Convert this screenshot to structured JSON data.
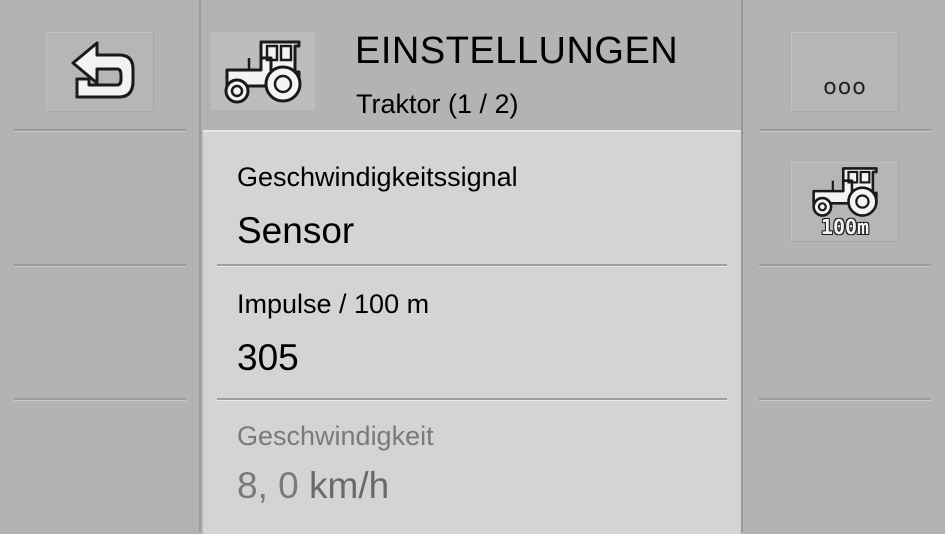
{
  "header": {
    "title": "EINSTELLUNGEN",
    "subtitle": "Traktor (1 / 2)",
    "icon": "tractor-icon"
  },
  "left_softkeys": [
    {
      "icon": "back-arrow-icon"
    }
  ],
  "right_softkeys": [
    {
      "icon": "more-dots-icon",
      "label": "ooo"
    },
    {
      "icon": "tractor-calibrate-icon",
      "label": "100m"
    }
  ],
  "settings": [
    {
      "label": "Geschwindigkeitssignal",
      "value": "Sensor",
      "enabled": true
    },
    {
      "label": "Impulse / 100 m",
      "value": "305",
      "enabled": true
    },
    {
      "label": "Geschwindigkeit",
      "value": "8, 0",
      "unit": "km/h",
      "enabled": false
    }
  ],
  "colors": {
    "background": "#b3b3b3",
    "panel": "#d4d4d4",
    "disabled_text": "#7a7a7a"
  }
}
